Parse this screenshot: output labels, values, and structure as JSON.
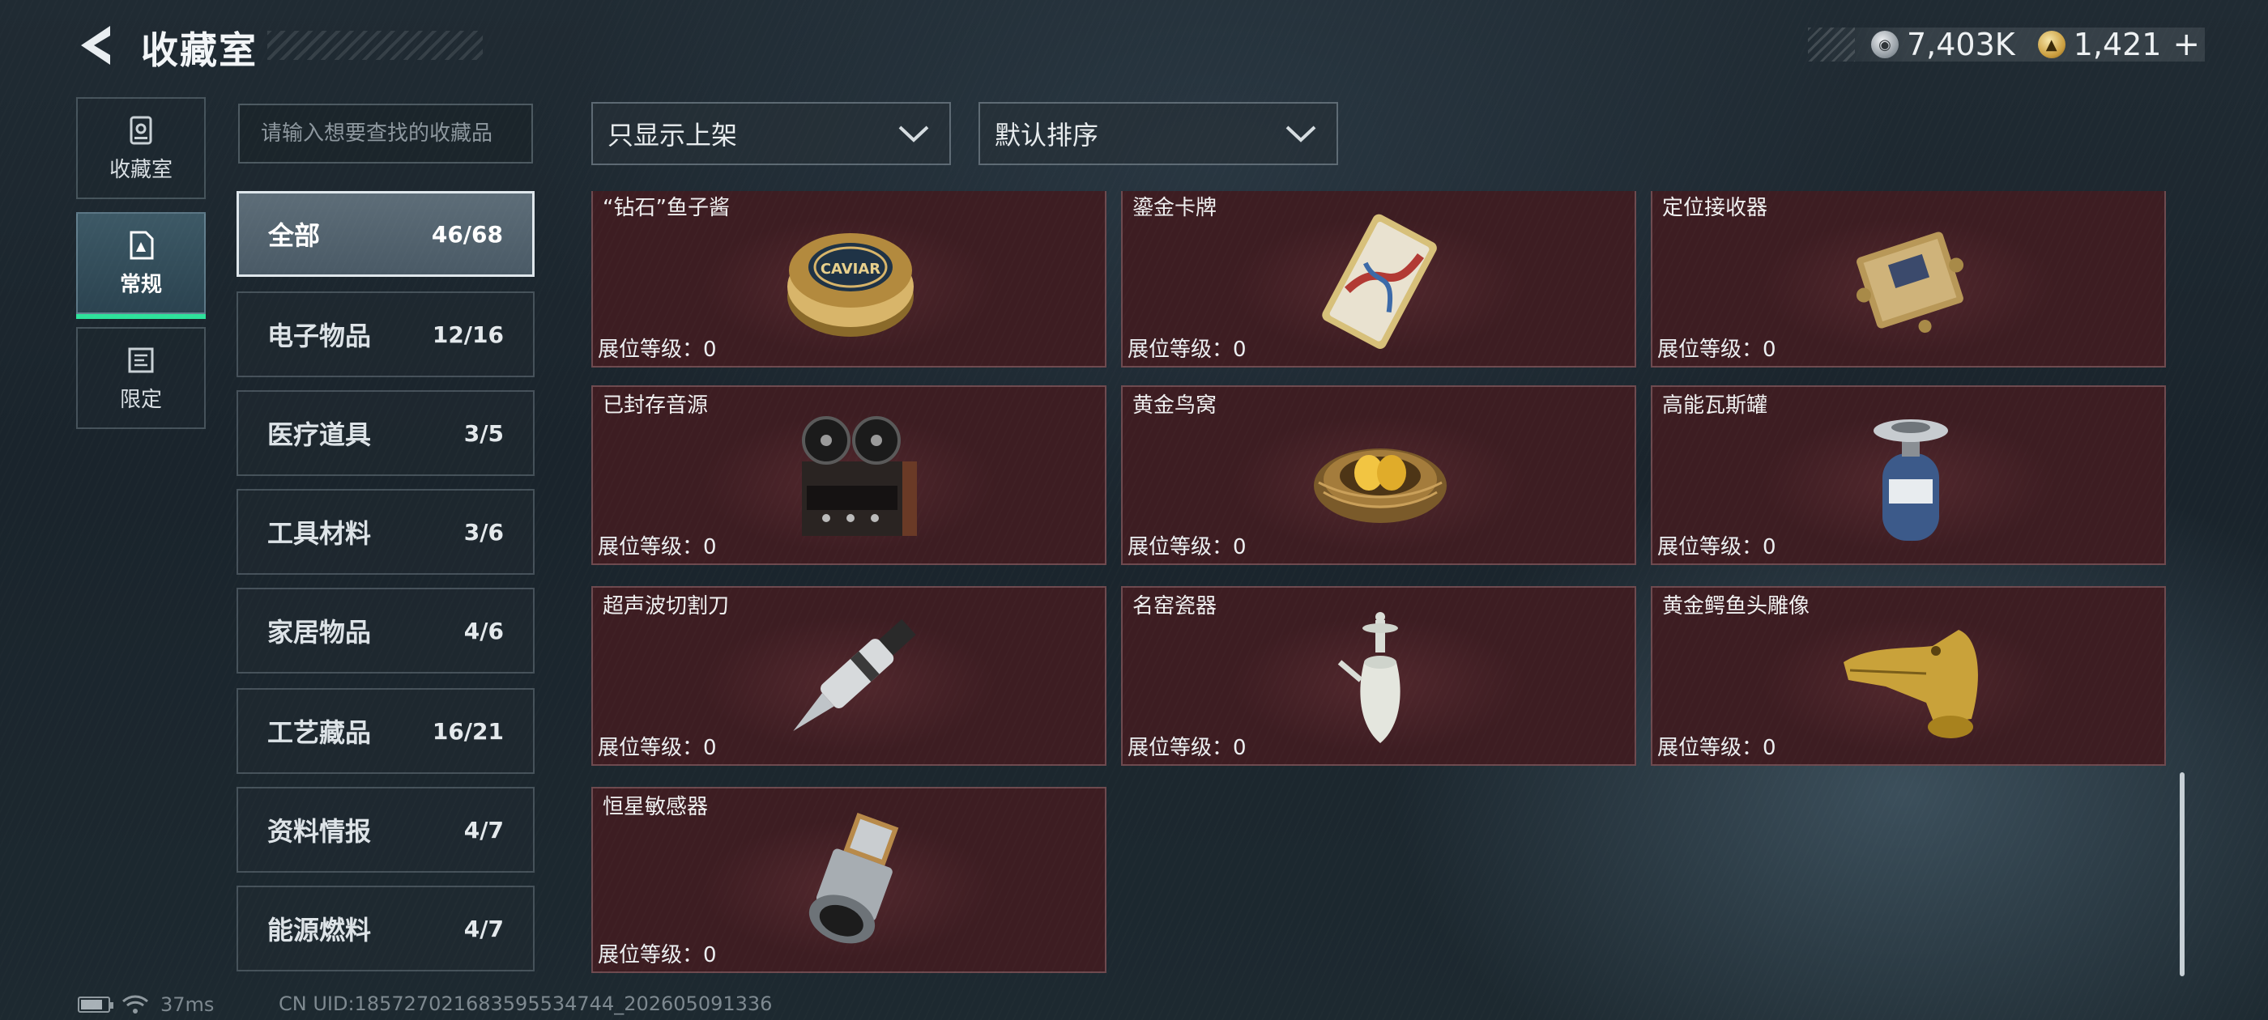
{
  "header": {
    "title": "收藏室",
    "currencies": [
      {
        "icon": "silver-coin-icon",
        "value": "7,403K"
      },
      {
        "icon": "gold-coin-icon",
        "value": "1,421"
      }
    ],
    "add_label": "+"
  },
  "nav": {
    "tabs": [
      {
        "label": "收藏室",
        "icon": "vault-icon"
      },
      {
        "label": "常规",
        "icon": "document-icon",
        "active": true
      },
      {
        "label": "限定",
        "icon": "scroll-icon"
      }
    ]
  },
  "search": {
    "placeholder": "请输入想要查找的收藏品"
  },
  "filters": {
    "show_filter": "只显示上架",
    "sort": "默认排序"
  },
  "categories": [
    {
      "name": "全部",
      "count": "46/68",
      "active": true
    },
    {
      "name": "电子物品",
      "count": "12/16"
    },
    {
      "name": "医疗道具",
      "count": "3/5"
    },
    {
      "name": "工具材料",
      "count": "3/6"
    },
    {
      "name": "家居物品",
      "count": "4/6"
    },
    {
      "name": "工艺藏品",
      "count": "16/21"
    },
    {
      "name": "资料情报",
      "count": "4/7"
    },
    {
      "name": "能源燃料",
      "count": "4/7"
    }
  ],
  "items": [
    {
      "name": "“钻石”鱼子酱",
      "level": "展位等级：0",
      "icon": "caviar-tin-icon",
      "art_text": "CAVIAR"
    },
    {
      "name": "鎏金卡牌",
      "level": "展位等级：0",
      "icon": "gilded-card-icon"
    },
    {
      "name": "定位接收器",
      "level": "展位等级：0",
      "icon": "locator-receiver-icon"
    },
    {
      "name": "已封存音源",
      "level": "展位等级：0",
      "icon": "reel-recorder-icon"
    },
    {
      "name": "黄金鸟窝",
      "level": "展位等级：0",
      "icon": "golden-nest-icon"
    },
    {
      "name": "高能瓦斯罐",
      "level": "展位等级：0",
      "icon": "gas-canister-icon"
    },
    {
      "name": "超声波切割刀",
      "level": "展位等级：0",
      "icon": "ultrasonic-cutter-icon"
    },
    {
      "name": "名窑瓷器",
      "level": "展位等级：0",
      "icon": "porcelain-ewer-icon"
    },
    {
      "name": "黄金鳄鱼头雕像",
      "level": "展位等级：0",
      "icon": "gold-crocodile-statue-icon"
    },
    {
      "name": "恒星敏感器",
      "level": "展位等级：0",
      "icon": "star-sensor-icon"
    }
  ],
  "footer": {
    "ping": "37ms",
    "uid": "CN UID:185727021683595534744_202605091336"
  },
  "colors": {
    "accent_green": "#2ee29b",
    "item_card_bg": "#3d1d22",
    "active_nav_bg": "#3d5966"
  }
}
